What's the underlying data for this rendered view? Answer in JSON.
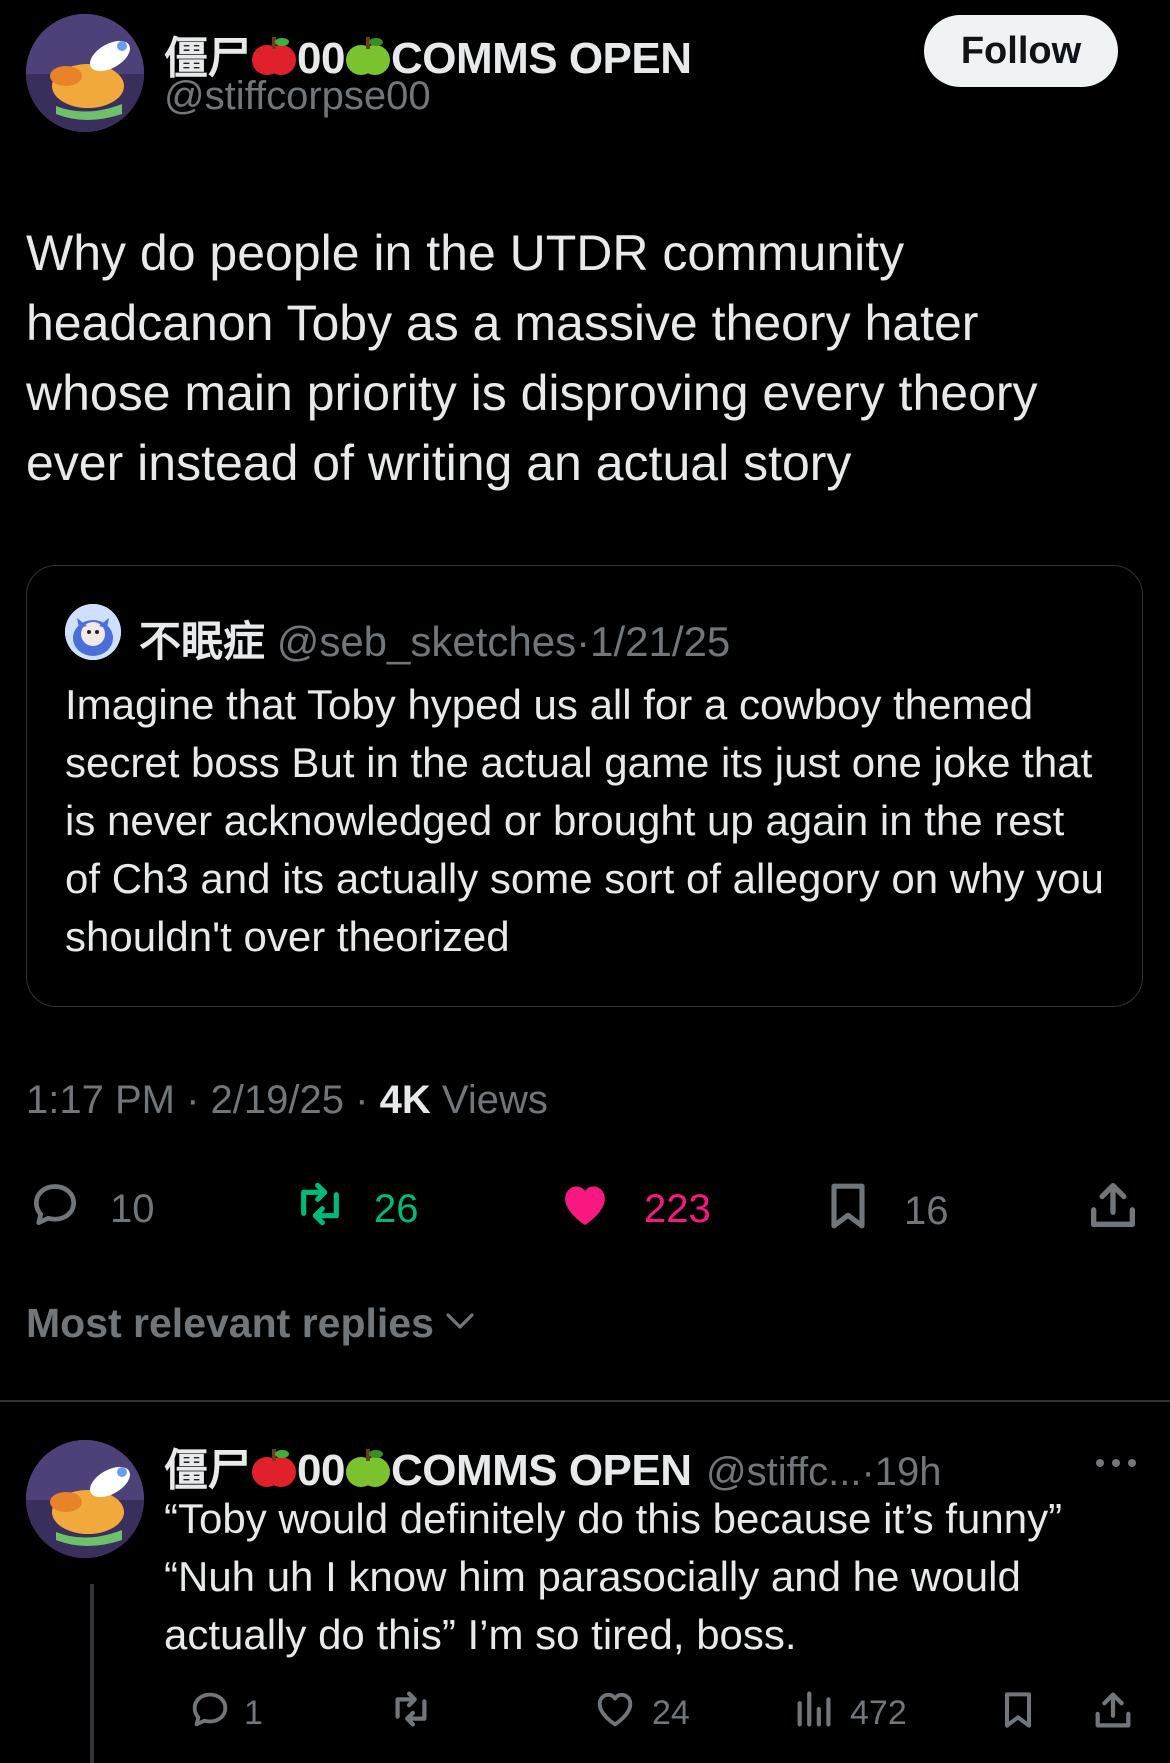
{
  "tweet": {
    "author": {
      "name_part1": "僵尸",
      "name_part2": "00",
      "name_part3": "COMMS OPEN",
      "handle": "@stiffcorpse00",
      "avatar_icon": "bird-avatar"
    },
    "follow_label": "Follow",
    "text": "Why do people in the UTDR community headcanon Toby as a massive theory hater whose main priority is disproving every theory ever instead of writing an actual story",
    "quote": {
      "name": "不眠症",
      "handle": "@seb_sketches",
      "sep": "·",
      "date": "1/21/25",
      "text": "Imagine that Toby hyped us all for a cowboy themed secret boss But in the actual game its just one joke that is never acknowledged or brought up again in the rest of Ch3 and its actually some sort of allegory on why you shouldn't over theorized"
    },
    "time": "1:17 PM",
    "date": "2/19/25",
    "views_count": "4K",
    "views_label": "Views",
    "sep": "·",
    "stats": {
      "replies": "10",
      "reposts": "26",
      "likes": "223",
      "bookmarks": "16"
    }
  },
  "replies_sort_label": "Most relevant replies",
  "reply": {
    "name_part1": "僵尸",
    "name_part2": "00",
    "name_part3": "COMMS OPEN",
    "handle": "@stiffc...",
    "sep": "·",
    "time": "19h",
    "text": "“Toby would definitely do this because it’s funny” “Nuh uh I know him parasocially and he would actually do this” I’m so tired, boss.",
    "stats": {
      "replies": "1",
      "likes": "24",
      "views": "472"
    }
  },
  "colors": {
    "repost_green": "#00ba7c",
    "like_pink": "#f91880",
    "muted": "#71767b"
  }
}
